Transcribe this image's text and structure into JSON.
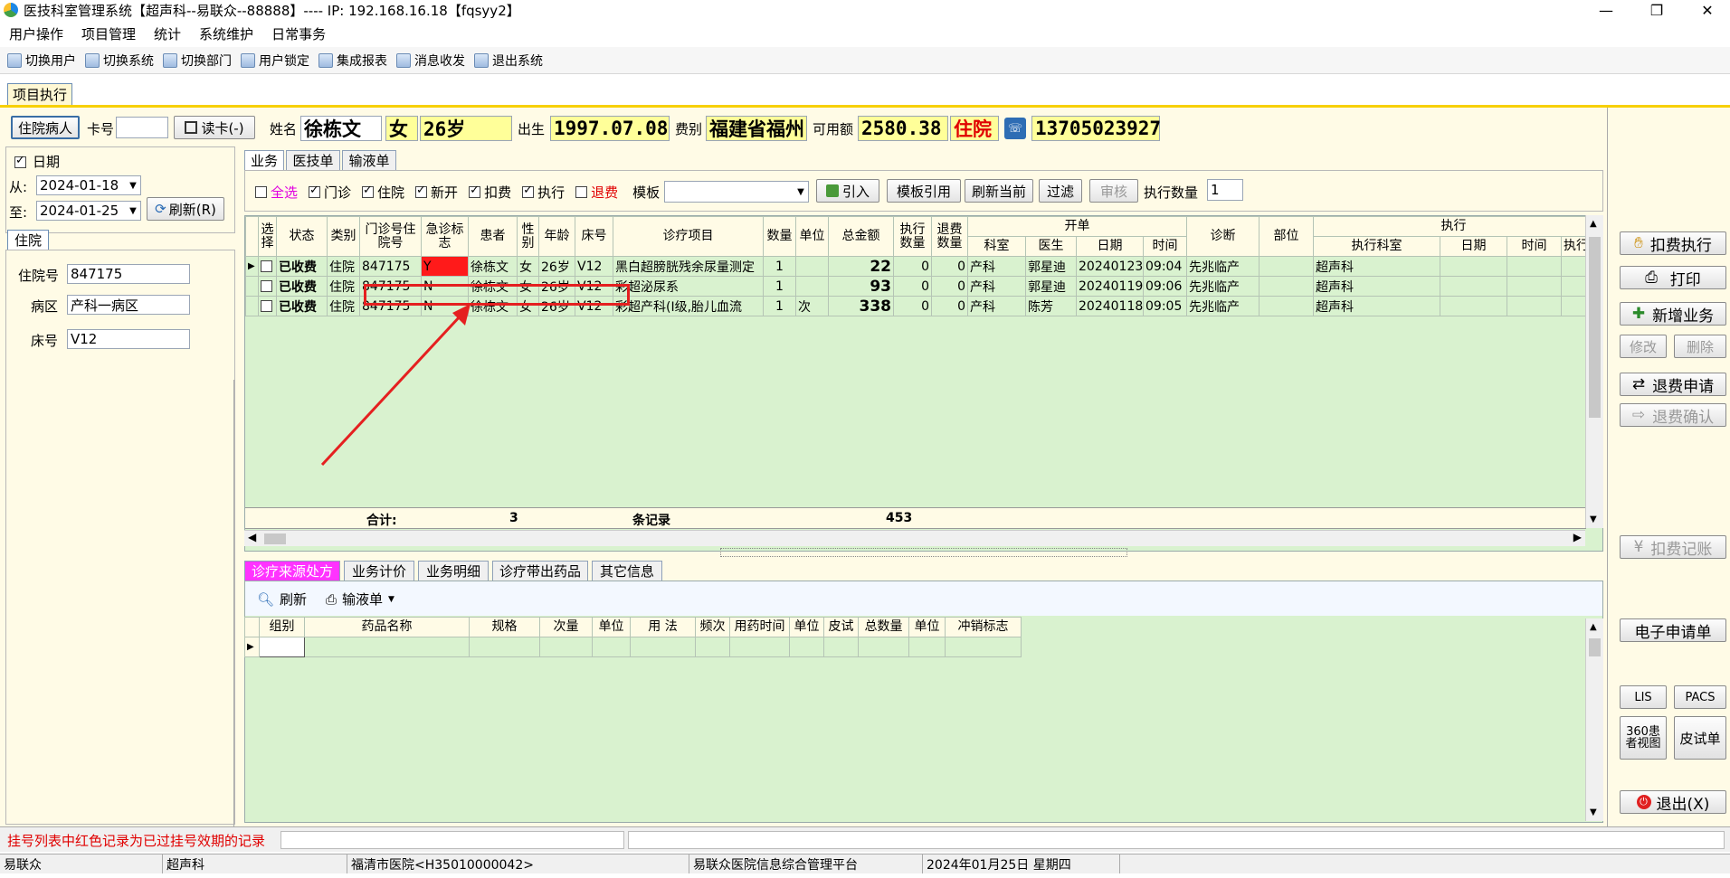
{
  "window": {
    "title": "医技科室管理系统【超声科--易联众--88888】---- IP: 192.168.16.18【fqsyy2】",
    "minimize": "—",
    "maximize": "❐",
    "close": "✕"
  },
  "menu": [
    "用户操作",
    "项目管理",
    "统计",
    "系统维护",
    "日常事务"
  ],
  "toolbar": [
    "切换用户",
    "切换系统",
    "切换部门",
    "用户锁定",
    "集成报表",
    "消息收发",
    "退出系统"
  ],
  "doc_tab": "项目执行",
  "patient": {
    "btn": "住院病人",
    "card_label": "卡号",
    "card_value": "",
    "read_btn": "读卡(-)",
    "name_label": "姓名",
    "name": "徐栋文",
    "sex": "女",
    "age": "26岁",
    "birth_label": "出生",
    "birth": "1997.07.08",
    "fee_label": "费别",
    "fee": "福建省福州",
    "avail_label": "可用额",
    "avail": "2580.38",
    "status": "住院",
    "phone": "13705023927"
  },
  "filter": {
    "date_label": "日期",
    "from_label": "从:",
    "from": "2024-01-18",
    "to_label": "至:",
    "to": "2024-01-25",
    "refresh": "刷新(R)"
  },
  "inpatient": {
    "tab": "住院",
    "no_label": "住院号",
    "no": "847175",
    "ward_label": "病区",
    "ward": "产科一病区",
    "bed_label": "床号",
    "bed": "V12"
  },
  "biz_tabs": [
    "业务",
    "医技单",
    "输液单"
  ],
  "opts": {
    "all": "全选",
    "outpatient": "门诊",
    "inpatient": "住院",
    "new": "新开",
    "charge": "扣费",
    "exec": "执行",
    "refund": "退费",
    "template_label": "模板",
    "template": "",
    "import": "引入",
    "tpl_ref": "模板引用",
    "refresh_cur": "刷新当前",
    "filter": "过滤",
    "audit": "审核",
    "exec_qty_label": "执行数量",
    "exec_qty": "1"
  },
  "grid": {
    "headers": [
      "选择",
      "状态",
      "类别",
      "门诊号住院号",
      "急诊标志",
      "患者",
      "性别",
      "年龄",
      "床号",
      "诊疗项目",
      "数量",
      "单位",
      "总金额",
      "执行数量",
      "退费数量",
      "科室",
      "医生",
      "日期",
      "时间",
      "诊断",
      "部位",
      "执行科室",
      "日期",
      "时间",
      "执行人"
    ],
    "group_open": "开单",
    "group_exec": "执行",
    "rows": [
      [
        "已收费",
        "住院",
        "847175",
        "Y",
        "徐栋文",
        "女",
        "26岁",
        "V12",
        "黑白超膀胱残余尿量测定",
        "1",
        "",
        "22",
        "0",
        "0",
        "产科",
        "郭星迪",
        "20240123",
        "09:04",
        "先兆临产",
        "",
        "超声科",
        "",
        "",
        ""
      ],
      [
        "已收费",
        "住院",
        "847175",
        "N",
        "徐栋文",
        "女",
        "26岁",
        "V12",
        "彩超泌尿系",
        "1",
        "",
        "93",
        "0",
        "0",
        "产科",
        "郭星迪",
        "20240119",
        "09:06",
        "先兆临产",
        "",
        "超声科",
        "",
        "",
        ""
      ],
      [
        "已收费",
        "住院",
        "847175",
        "N",
        "徐栋文",
        "女",
        "26岁",
        "V12",
        "彩超产科(I级,胎儿血流",
        "1",
        "次",
        "338",
        "0",
        "0",
        "产科",
        "陈芳",
        "20240118",
        "09:05",
        "先兆临产",
        "",
        "超声科",
        "",
        "",
        ""
      ]
    ],
    "total_label": "合计:",
    "total_count": "3",
    "total_unit": "条记录",
    "total_amount": "453"
  },
  "bottom_tabs": [
    "诊疗来源处方",
    "业务计价",
    "业务明细",
    "诊疗带出药品",
    "其它信息"
  ],
  "bottom_toolbar": {
    "refresh": "刷新",
    "infusion": "输液单"
  },
  "drug_grid": {
    "headers": [
      "组别",
      "药品名称",
      "规格",
      "次量",
      "单位",
      "用 法",
      "频次",
      "用药时间",
      "单位",
      "皮试",
      "总数量",
      "单位",
      "冲销标志"
    ]
  },
  "right_buttons": {
    "charge_exec": "扣费执行",
    "print": "打印",
    "new_biz": "新增业务",
    "modify": "修改",
    "delete": "删除",
    "refund_apply": "退费申请",
    "refund_confirm": "退费确认",
    "charge_record": "扣费记账",
    "e_apply": "电子申请单",
    "lis": "LIS",
    "pacs": "PACS",
    "view360": "360患者视图",
    "skin_test": "皮试单",
    "exit": "退出(X)"
  },
  "status_hint": "挂号列表中红色记录为已过挂号效期的记录",
  "statusbar": [
    "易联众",
    "超声科",
    "福清市医院<H35010000042>",
    "易联众医院信息综合管理平台",
    "2024年01月25日 星期四"
  ]
}
